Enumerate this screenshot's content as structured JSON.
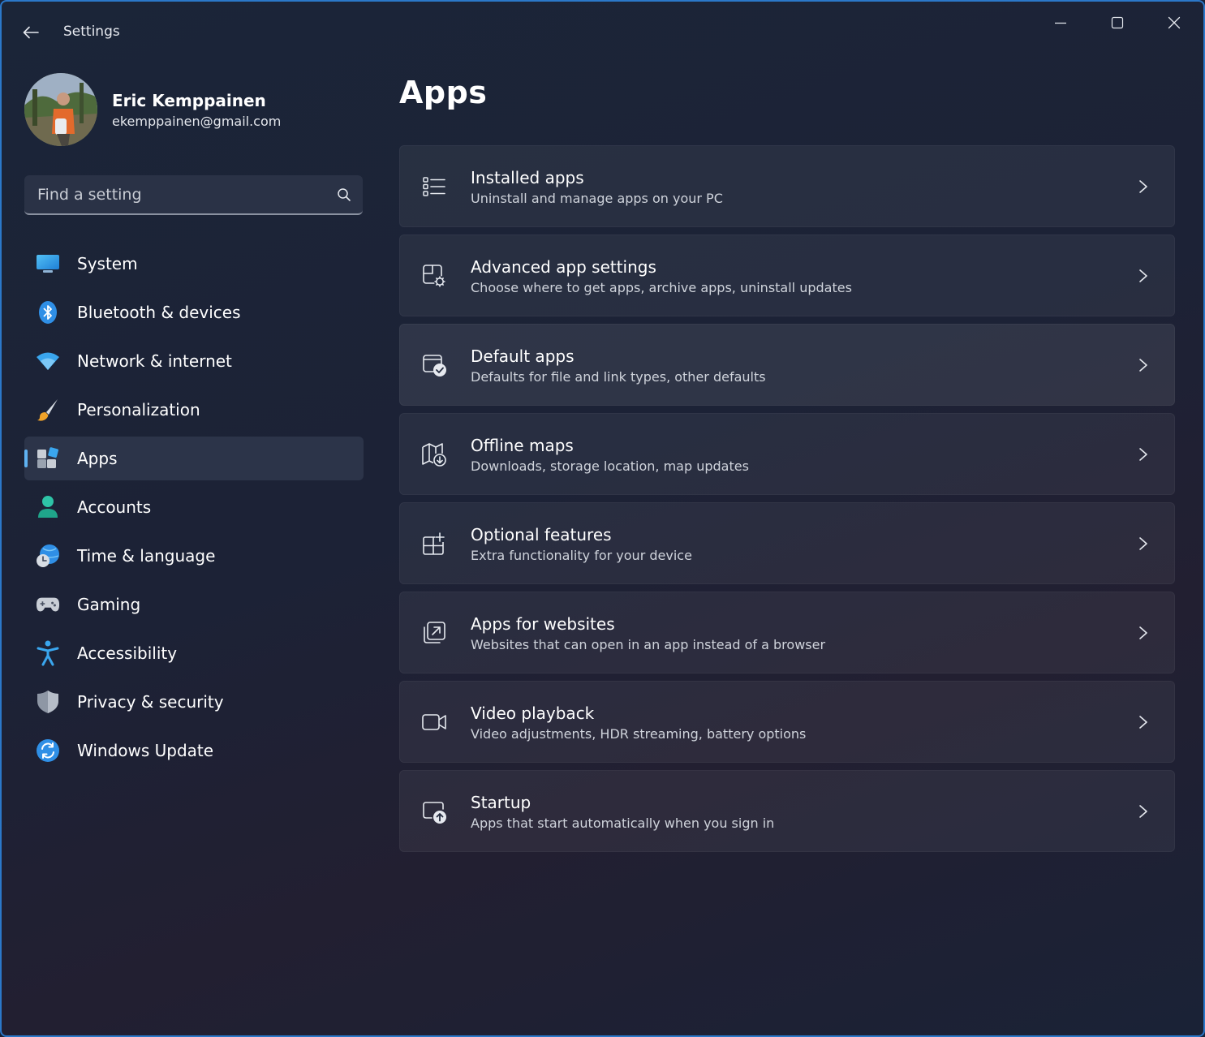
{
  "window": {
    "title": "Settings",
    "accent": "#5fb2f2"
  },
  "profile": {
    "name": "Eric Kemppainen",
    "email": "ekemppainen@gmail.com"
  },
  "search": {
    "placeholder": "Find a setting"
  },
  "nav": {
    "selected": "Apps",
    "items": [
      {
        "label": "System",
        "icon": "monitor-icon"
      },
      {
        "label": "Bluetooth & devices",
        "icon": "bluetooth-icon"
      },
      {
        "label": "Network & internet",
        "icon": "wifi-icon"
      },
      {
        "label": "Personalization",
        "icon": "brush-icon"
      },
      {
        "label": "Apps",
        "icon": "apps-icon"
      },
      {
        "label": "Accounts",
        "icon": "person-icon"
      },
      {
        "label": "Time & language",
        "icon": "globe-clock-icon"
      },
      {
        "label": "Gaming",
        "icon": "gamepad-icon"
      },
      {
        "label": "Accessibility",
        "icon": "accessibility-icon"
      },
      {
        "label": "Privacy & security",
        "icon": "shield-icon"
      },
      {
        "label": "Windows Update",
        "icon": "update-icon"
      }
    ]
  },
  "main": {
    "title": "Apps",
    "cards": [
      {
        "title": "Installed apps",
        "desc": "Uninstall and manage apps on your PC",
        "icon": "list-icon"
      },
      {
        "title": "Advanced app settings",
        "desc": "Choose where to get apps, archive apps, uninstall updates",
        "icon": "app-gear-icon"
      },
      {
        "title": "Default apps",
        "desc": "Defaults for file and link types, other defaults",
        "icon": "app-check-icon"
      },
      {
        "title": "Offline maps",
        "desc": "Downloads, storage location, map updates",
        "icon": "map-download-icon"
      },
      {
        "title": "Optional features",
        "desc": "Extra functionality for your device",
        "icon": "grid-plus-icon"
      },
      {
        "title": "Apps for websites",
        "desc": "Websites that can open in an app instead of a browser",
        "icon": "open-external-icon"
      },
      {
        "title": "Video playback",
        "desc": "Video adjustments, HDR streaming, battery options",
        "icon": "video-camera-icon"
      },
      {
        "title": "Startup",
        "desc": "Apps that start automatically when you sign in",
        "icon": "startup-icon"
      }
    ]
  }
}
